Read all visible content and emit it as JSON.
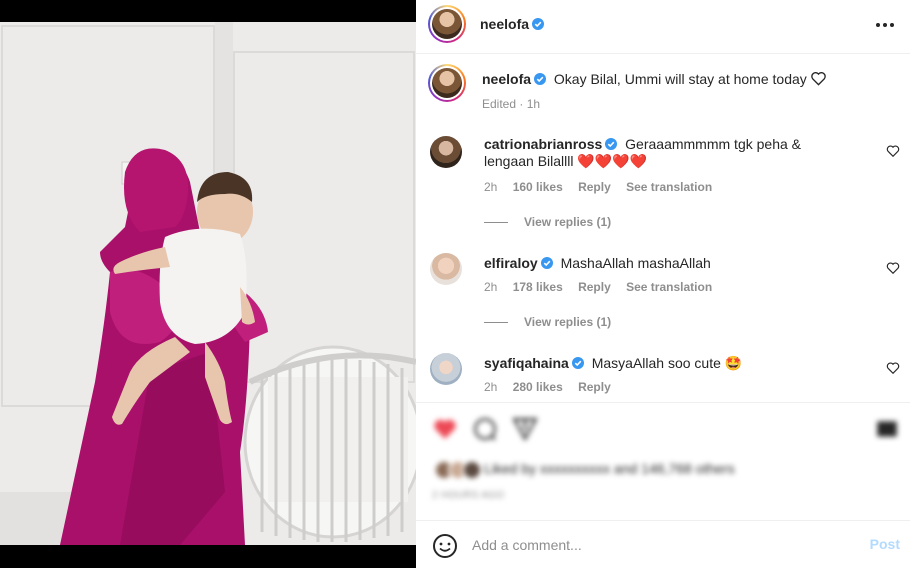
{
  "post": {
    "author": "neelofa",
    "caption": "Okay Bilal, Ummi will stay at home today",
    "edited_label": "Edited",
    "time_ago": "1h"
  },
  "comments": [
    {
      "username": "catrionabrianross",
      "text": "Geraaammmmm tgk peha & lengaan Bilallll",
      "emoji": "❤️❤️❤️❤️",
      "time": "2h",
      "likes": "160 likes",
      "reply": "Reply",
      "see_translation": "See translation",
      "view_replies": "View replies (1)"
    },
    {
      "username": "elfiraloy",
      "text": "MashaAllah mashaAllah",
      "time": "2h",
      "likes": "178 likes",
      "reply": "Reply",
      "see_translation": "See translation",
      "view_replies": "View replies (1)"
    },
    {
      "username": "syafiqahaina",
      "text": "MasyaAllah soo cute",
      "emoji": "🤩",
      "time": "2h",
      "likes": "280 likes",
      "reply": "Reply"
    }
  ],
  "engagement": {
    "likes_text": "Liked by xxxxxxxxxx and 146,768 others",
    "timestamp": "2 HOURS AGO"
  },
  "add_comment": {
    "placeholder": "Add a comment...",
    "post_label": "Post"
  },
  "colors": {
    "verified_blue": "#3897f0",
    "like_red": "#ed4956",
    "post_disabled": "#b3dbff",
    "hijab_magenta": "#b0136e"
  }
}
